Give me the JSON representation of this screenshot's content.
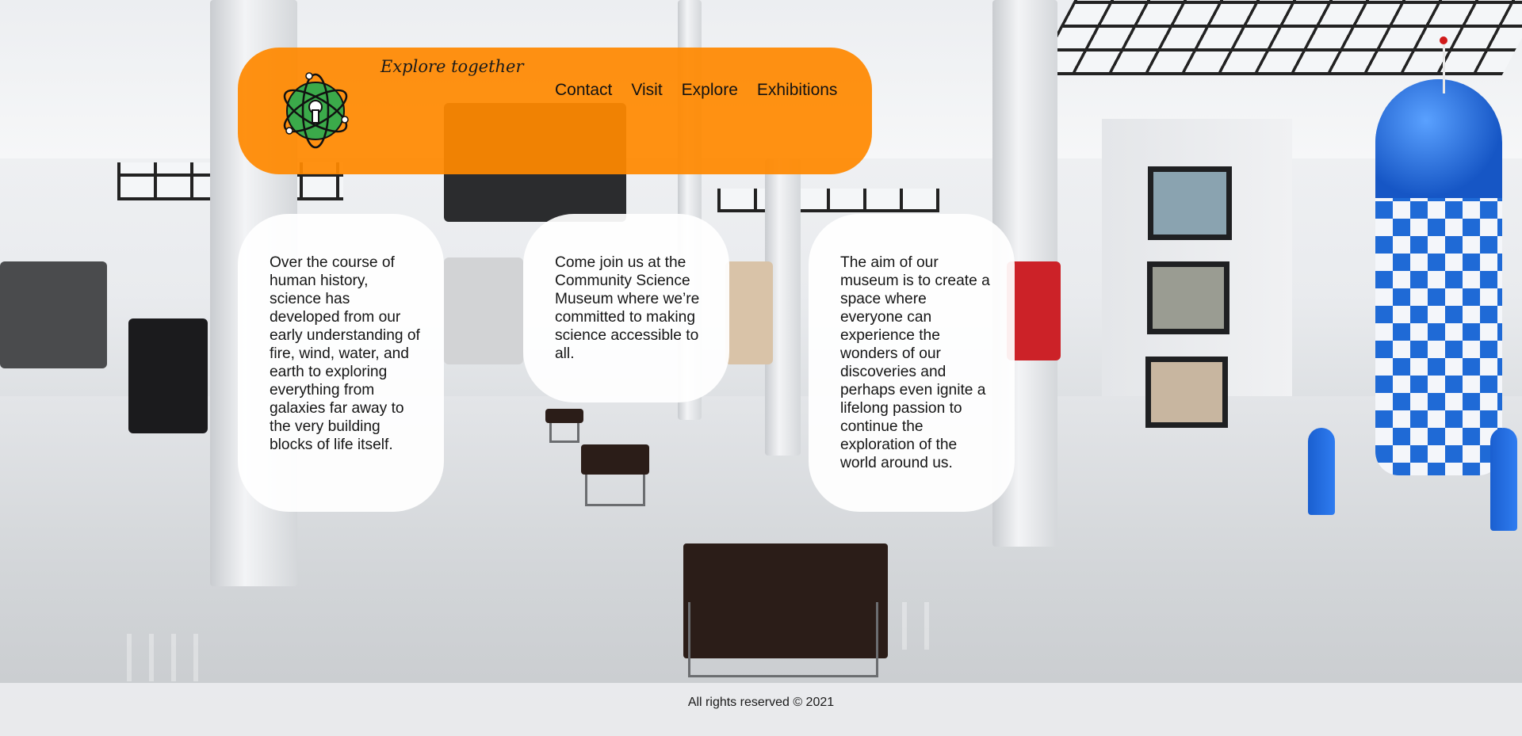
{
  "header": {
    "tagline": "Explore together",
    "logo_icon": "atom-logo-icon",
    "nav": [
      "Contact",
      "Visit",
      "Explore",
      "Exhibitions"
    ]
  },
  "cards": [
    {
      "text": "Over the course of human history, science has developed from our early understanding of fire, wind, water, and earth to exploring everything from galaxies far away to the very building blocks of life itself."
    },
    {
      "text": "Come join us at the Community Science Museum where we’re committed to making science accessible to all."
    },
    {
      "text": "The aim of our museum is to create a space where everyone can experience the wonders of our discoveries and perhaps even ignite a lifelong passion to continue the exploration of the world around us."
    }
  ],
  "footer": {
    "text": "All rights reserved © 2021"
  },
  "colors": {
    "accent": "#FF8900",
    "card": "#FFFFFF",
    "logo_green": "#3BAA4A"
  }
}
